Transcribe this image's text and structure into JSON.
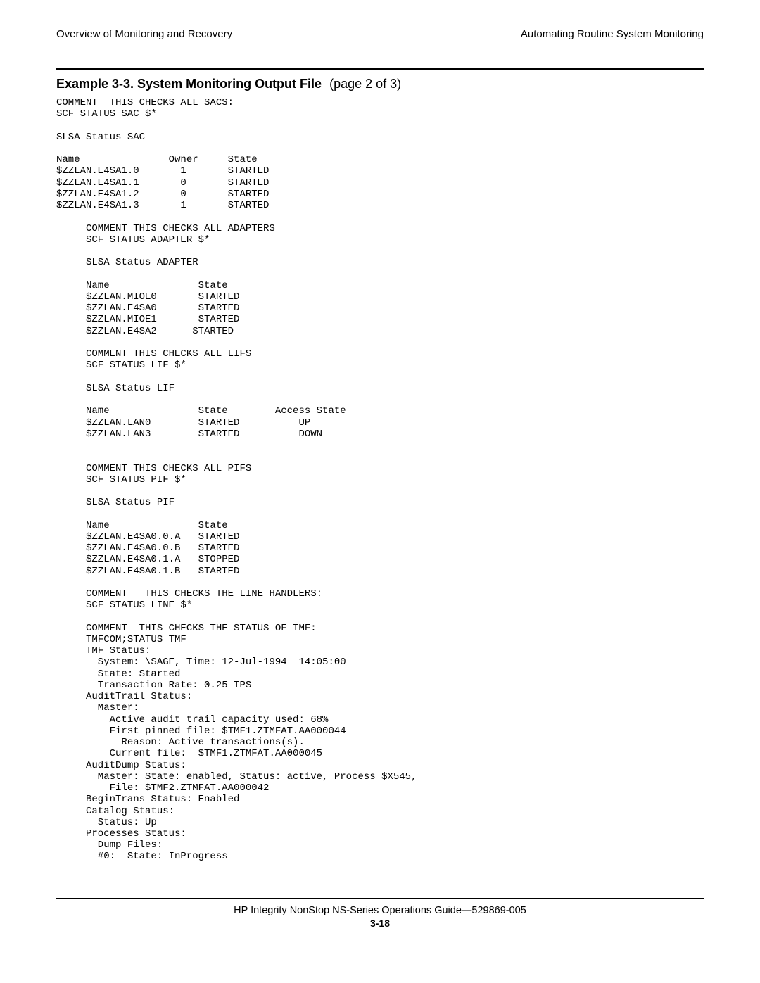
{
  "header": {
    "left": "Overview of Monitoring and Recovery",
    "right": "Automating Routine System Monitoring"
  },
  "example": {
    "label": "Example 3-3.  System Monitoring Output File",
    "page_note": "(page 2 of 3)"
  },
  "code": "COMMENT  THIS CHECKS ALL SACS:\nSCF STATUS SAC $*\n\nSLSA Status SAC\n\nName               Owner     State\n$ZZLAN.E4SA1.0       1       STARTED\n$ZZLAN.E4SA1.1       0       STARTED\n$ZZLAN.E4SA1.2       0       STARTED\n$ZZLAN.E4SA1.3       1       STARTED\n\n     COMMENT THIS CHECKS ALL ADAPTERS\n     SCF STATUS ADAPTER $*\n\n     SLSA Status ADAPTER\n\n     Name               State\n     $ZZLAN.MIOE0       STARTED\n     $ZZLAN.E4SA0       STARTED\n     $ZZLAN.MIOE1       STARTED\n     $ZZLAN.E4SA2      STARTED\n\n     COMMENT THIS CHECKS ALL LIFS\n     SCF STATUS LIF $*\n\n     SLSA Status LIF\n\n     Name               State        Access State\n     $ZZLAN.LAN0        STARTED          UP\n     $ZZLAN.LAN3        STARTED          DOWN\n\n\n     COMMENT THIS CHECKS ALL PIFS\n     SCF STATUS PIF $*\n\n     SLSA Status PIF\n\n     Name               State\n     $ZZLAN.E4SA0.0.A   STARTED\n     $ZZLAN.E4SA0.0.B   STARTED\n     $ZZLAN.E4SA0.1.A   STOPPED\n     $ZZLAN.E4SA0.1.B   STARTED\n\n     COMMENT   THIS CHECKS THE LINE HANDLERS:\n     SCF STATUS LINE $*\n\n     COMMENT  THIS CHECKS THE STATUS OF TMF:\n     TMFCOM;STATUS TMF\n     TMF Status:\n       System: \\SAGE, Time: 12-Jul-1994  14:05:00\n       State: Started\n       Transaction Rate: 0.25 TPS\n     AuditTrail Status:\n       Master:\n         Active audit trail capacity used: 68%\n         First pinned file: $TMF1.ZTMFAT.AA000044\n           Reason: Active transactions(s).\n         Current file:  $TMF1.ZTMFAT.AA000045\n     AuditDump Status:\n       Master: State: enabled, Status: active, Process $X545,\n         File: $TMF2.ZTMFAT.AA000042\n     BeginTrans Status: Enabled\n     Catalog Status:\n       Status: Up\n     Processes Status:\n       Dump Files:\n       #0:  State: InProgress",
  "footer": {
    "line": "HP Integrity NonStop NS-Series Operations Guide—529869-005",
    "page": "3-18"
  }
}
